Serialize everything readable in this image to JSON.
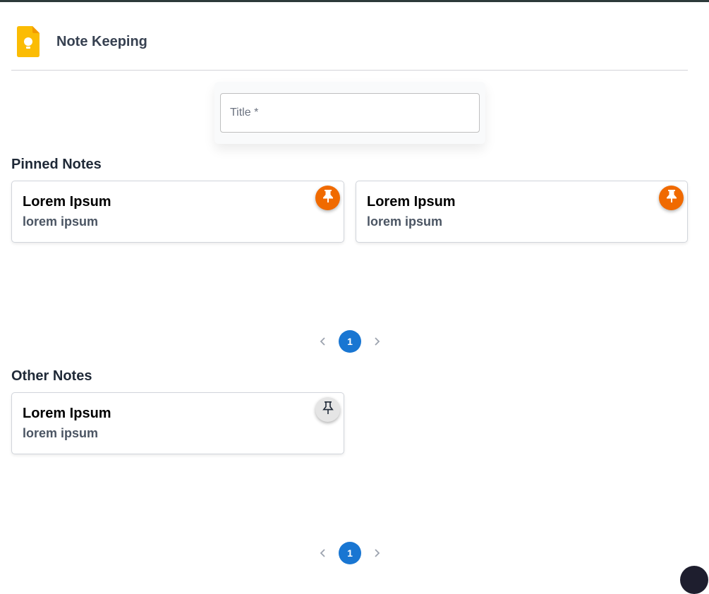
{
  "app": {
    "title": "Note Keeping"
  },
  "create_note": {
    "title_placeholder": "Title *"
  },
  "pinned_section": {
    "heading": "Pinned Notes",
    "notes": [
      {
        "title": "Lorem Ipsum",
        "body": "lorem ipsum",
        "pin_icon": "pushpin-filled-icon"
      },
      {
        "title": "Lorem Ipsum",
        "body": "lorem ipsum",
        "pin_icon": "pushpin-filled-icon"
      }
    ],
    "pagination": {
      "current_page": "1"
    }
  },
  "other_section": {
    "heading": "Other Notes",
    "notes": [
      {
        "title": "Lorem Ipsum",
        "body": "lorem ipsum",
        "pin_icon": "pushpin-outline-icon"
      }
    ],
    "pagination": {
      "current_page": "1"
    }
  },
  "colors": {
    "pinned_accent": "#f06a00",
    "pagination_active": "#1976d2",
    "logo_yellow": "#fbbc04"
  }
}
